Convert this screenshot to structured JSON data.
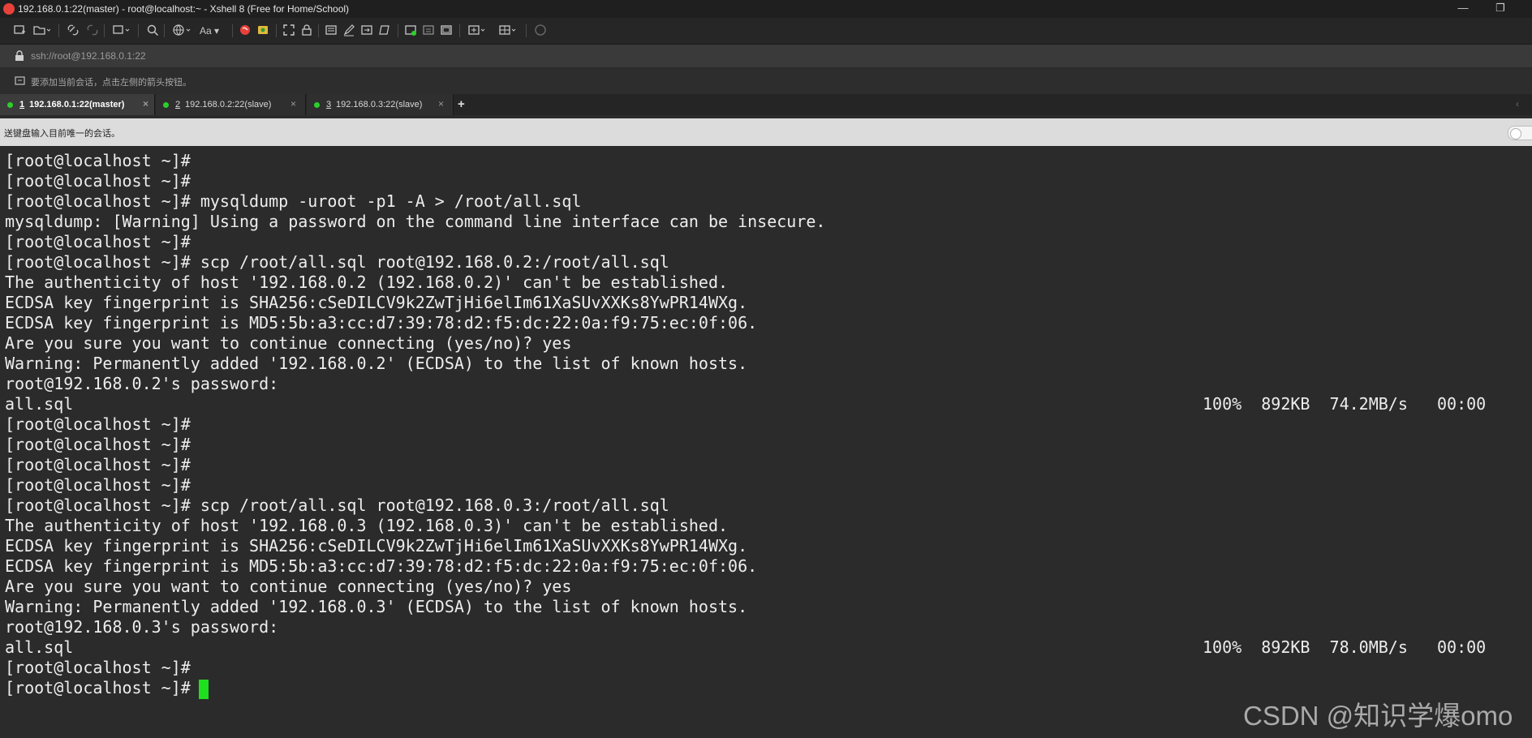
{
  "window": {
    "title": "192.168.0.1:22(master) - root@localhost:~ - Xshell 8 (Free for Home/School)",
    "minimize_symbol": "—",
    "restore_symbol": "❐"
  },
  "toolbar": {
    "icons": [
      "new-session-icon",
      "open-folder-icon",
      "link-icon",
      "unlink-icon",
      "new-tab-icon",
      "find-icon",
      "globe-icon",
      "font-icon",
      "xshell-icon",
      "xftp-icon",
      "fullscreen-icon",
      "lock-icon",
      "compose-icon",
      "highlight-icon",
      "transfer-icon",
      "script-icon",
      "new-window-icon",
      "sftp-icon",
      "log-icon",
      "layout-icon",
      "tile-icon",
      "chat-icon"
    ]
  },
  "address": {
    "url": "ssh://root@192.168.0.1:22"
  },
  "hint": {
    "text": "要添加当前会话，点击左侧的箭头按钮。"
  },
  "tabs": [
    {
      "number": "1",
      "label": "192.168.0.1:22(master)",
      "active": true
    },
    {
      "number": "2",
      "label": "192.168.0.2:22(slave)",
      "active": false
    },
    {
      "number": "3",
      "label": "192.168.0.3:22(slave)",
      "active": false
    }
  ],
  "tab_add_label": "+",
  "compose": {
    "text": "送键盘输入目前唯一的会话。"
  },
  "terminal": {
    "lines": [
      "[root@localhost ~]#",
      "[root@localhost ~]#",
      "[root@localhost ~]# mysqldump -uroot -p1 -A > /root/all.sql",
      "mysqldump: [Warning] Using a password on the command line interface can be insecure.",
      "[root@localhost ~]#",
      "[root@localhost ~]# scp /root/all.sql root@192.168.0.2:/root/all.sql",
      "The authenticity of host '192.168.0.2 (192.168.0.2)' can't be established.",
      "ECDSA key fingerprint is SHA256:cSeDILCV9k2ZwTjHi6elIm61XaSUvXXKs8YwPR14WXg.",
      "ECDSA key fingerprint is MD5:5b:a3:cc:d7:39:78:d2:f5:dc:22:0a:f9:75:ec:0f:06.",
      "Are you sure you want to continue connecting (yes/no)? yes",
      "Warning: Permanently added '192.168.0.2' (ECDSA) to the list of known hosts.",
      "root@192.168.0.2's password:",
      "all.sql",
      "[root@localhost ~]#",
      "[root@localhost ~]#",
      "[root@localhost ~]#",
      "[root@localhost ~]#",
      "[root@localhost ~]# scp /root/all.sql root@192.168.0.3:/root/all.sql",
      "The authenticity of host '192.168.0.3 (192.168.0.3)' can't be established.",
      "ECDSA key fingerprint is SHA256:cSeDILCV9k2ZwTjHi6elIm61XaSUvXXKs8YwPR14WXg.",
      "ECDSA key fingerprint is MD5:5b:a3:cc:d7:39:78:d2:f5:dc:22:0a:f9:75:ec:0f:06.",
      "Are you sure you want to continue connecting (yes/no)? yes",
      "Warning: Permanently added '192.168.0.3' (ECDSA) to the list of known hosts.",
      "root@192.168.0.3's password:",
      "all.sql",
      "[root@localhost ~]#",
      "[root@localhost ~]#"
    ],
    "transfer_stats": [
      "100%  892KB  74.2MB/s   00:00",
      "100%  892KB  78.0MB/s   00:00"
    ]
  },
  "watermark": "CSDN @知识学爆omo",
  "colors": {
    "terminal_bg": "#2b2b2b",
    "terminal_fg": "#ededed",
    "cursor": "#1fe01f",
    "tab_dot": "#2ccf2c"
  }
}
